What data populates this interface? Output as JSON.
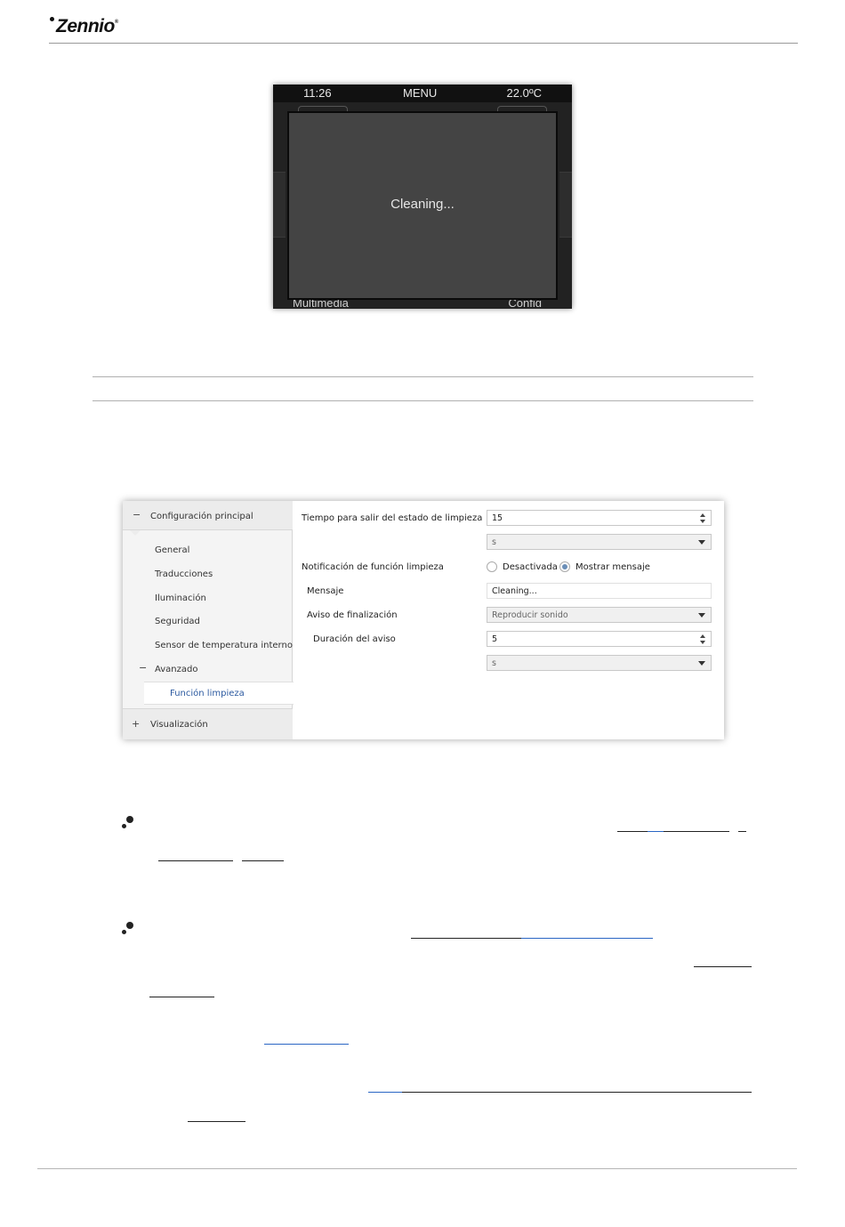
{
  "header": {
    "logo": "Zennio"
  },
  "device": {
    "time": "11:26",
    "menu": "MENU",
    "temperature": "22.0ºC",
    "popup_text": "Cleaning...",
    "bottom_left": "Multimedia",
    "bottom_right": "Config"
  },
  "ets": {
    "tree": {
      "main_section": "Configuración principal",
      "items": [
        "General",
        "Traducciones",
        "Iluminación",
        "Seguridad",
        "Sensor de temperatura interno"
      ],
      "advanced": "Avanzado",
      "selected": "Función limpieza",
      "display_section": "Visualización"
    },
    "params": {
      "exit_time_label": "Tiempo para salir del estado de limpieza",
      "exit_time_value": "15",
      "exit_time_unit": "s",
      "notification_label": "Notificación de función limpieza",
      "radio_off": "Desactivada",
      "radio_show": "Mostrar mensaje",
      "message_label": "Mensaje",
      "message_value": "Cleaning...",
      "end_notice_label": "Aviso de finalización",
      "end_notice_value": "Reproducir sonido",
      "duration_label": "Duración del aviso",
      "duration_value": "5",
      "duration_unit": "s"
    }
  }
}
